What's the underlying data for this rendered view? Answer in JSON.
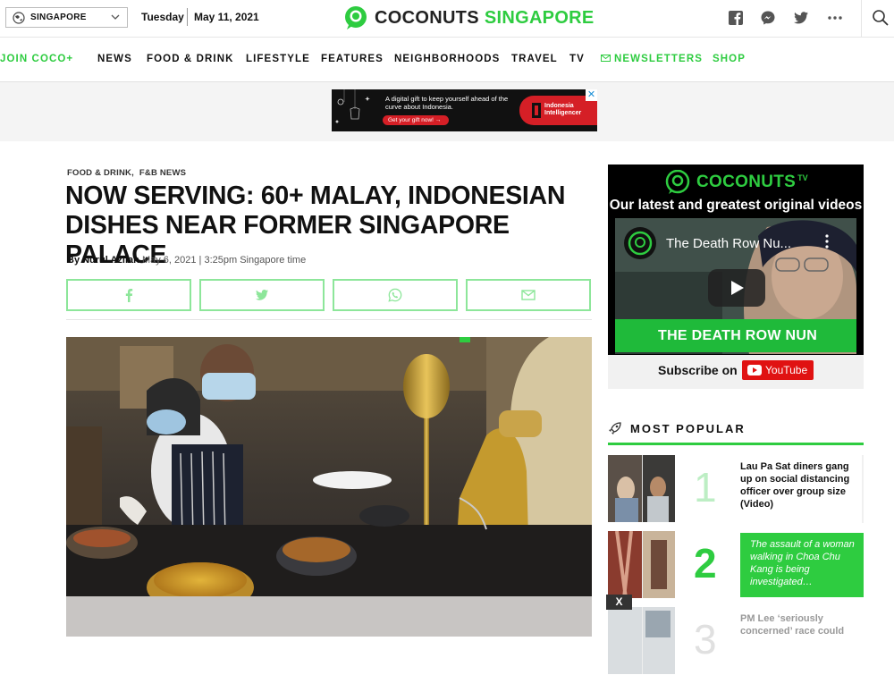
{
  "topbar": {
    "city": "SINGAPORE",
    "day": "Tuesday",
    "date": "May 11, 2021",
    "logo_main": "COCONUTS",
    "logo_city": "SINGAPORE"
  },
  "nav": {
    "items": [
      "JOIN COCO+",
      "NEWS",
      "FOOD & DRINK",
      "LIFESTYLE",
      "FEATURES",
      "NEIGHBORHOODS",
      "TRAVEL",
      "TV",
      "NEWSLETTERS",
      "SHOP"
    ]
  },
  "ad": {
    "line1": "A digital gift to keep yourself ahead of the curve about Indonesia.",
    "button": "Get your gift now!  →",
    "brand_line1": "Indonesia",
    "brand_line2": "Intelligencer",
    "close": "✕"
  },
  "article": {
    "categories": [
      "FOOD & DRINK,",
      "F&B NEWS"
    ],
    "headline": "NOW SERVING: 60+ MALAY, INDONESIAN DISHES NEAR FORMER SINGAPORE PALACE",
    "by_prefix": "By Nurul Azliah",
    "timestamp": "May 6, 2021 | 3:25pm Singapore time"
  },
  "sidebar": {
    "tv": {
      "logo": "COCONUTS",
      "logo_sup": "TV",
      "tagline": "Our latest and greatest original videos",
      "video_title": "The Death Row Nu...",
      "video_banner": "THE DEATH ROW NUN",
      "subscribe_label": "Subscribe on",
      "youtube": "YouTube"
    },
    "most_popular": {
      "heading": "MOST POPULAR",
      "items": [
        {
          "rank": "1",
          "title": "Lau Pa Sat diners gang up on social distancing officer over group size (Video)"
        },
        {
          "rank": "2",
          "title": "The assault of a woman walking in Choa Chu Kang is being investigated…"
        },
        {
          "rank": "3",
          "title": "PM Lee ‘seriously concerned’ race could"
        }
      ]
    },
    "close_label": "X"
  },
  "colors": {
    "brand_green": "#2ecc40",
    "share_border": "#8de69a"
  }
}
